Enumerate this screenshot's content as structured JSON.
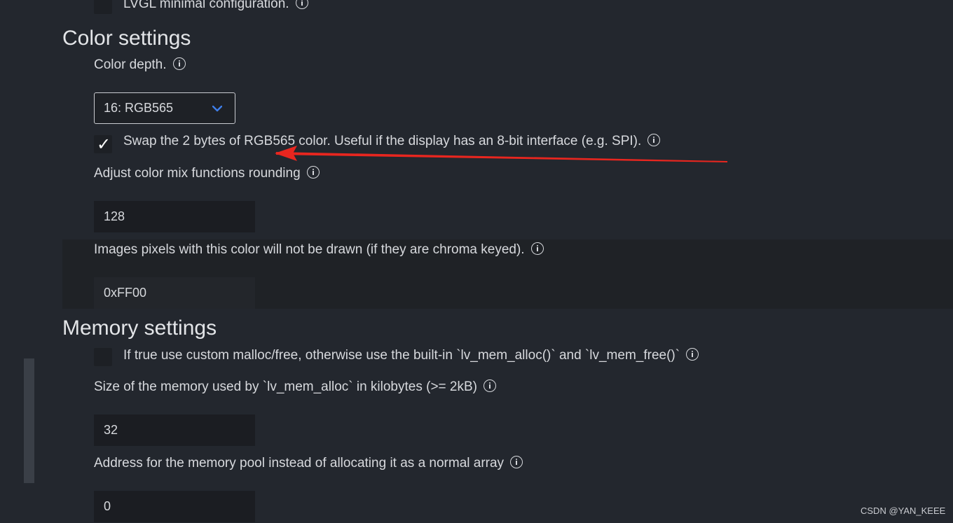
{
  "settings": {
    "lvgl_minimal_label": "LVGL minimal configuration.",
    "color_section_title": "Color settings",
    "color_depth_label": "Color depth.",
    "color_depth_value": "16: RGB565",
    "swap_bytes_label": "Swap the 2 bytes of RGB565 color. Useful if the display has an 8-bit interface (e.g. SPI).",
    "swap_bytes_checked": true,
    "mix_rounding_label": "Adjust color mix functions rounding",
    "mix_rounding_value": "128",
    "chroma_key_label": "Images pixels with this color will not be drawn (if they are chroma keyed).",
    "chroma_key_value": "0xFF00",
    "memory_section_title": "Memory settings",
    "custom_malloc_label": "If true use custom malloc/free, otherwise use the built-in `lv_mem_alloc()` and `lv_mem_free()`",
    "custom_malloc_checked": false,
    "mem_size_label": "Size of the memory used by `lv_mem_alloc` in kilobytes (>= 2kB)",
    "mem_size_value": "32",
    "mem_address_label": "Address for the memory pool instead of allocating it as a normal array",
    "mem_address_value": "0"
  },
  "icons": {
    "info": "info-icon",
    "dropdown": "chevron-down-icon",
    "check": "checkmark-icon"
  },
  "colors": {
    "background": "#23272e",
    "arrow_annotation": "#e8261f",
    "dropdown_chevron": "#3f7ee8"
  },
  "watermark": "CSDN @YAN_KEEE"
}
